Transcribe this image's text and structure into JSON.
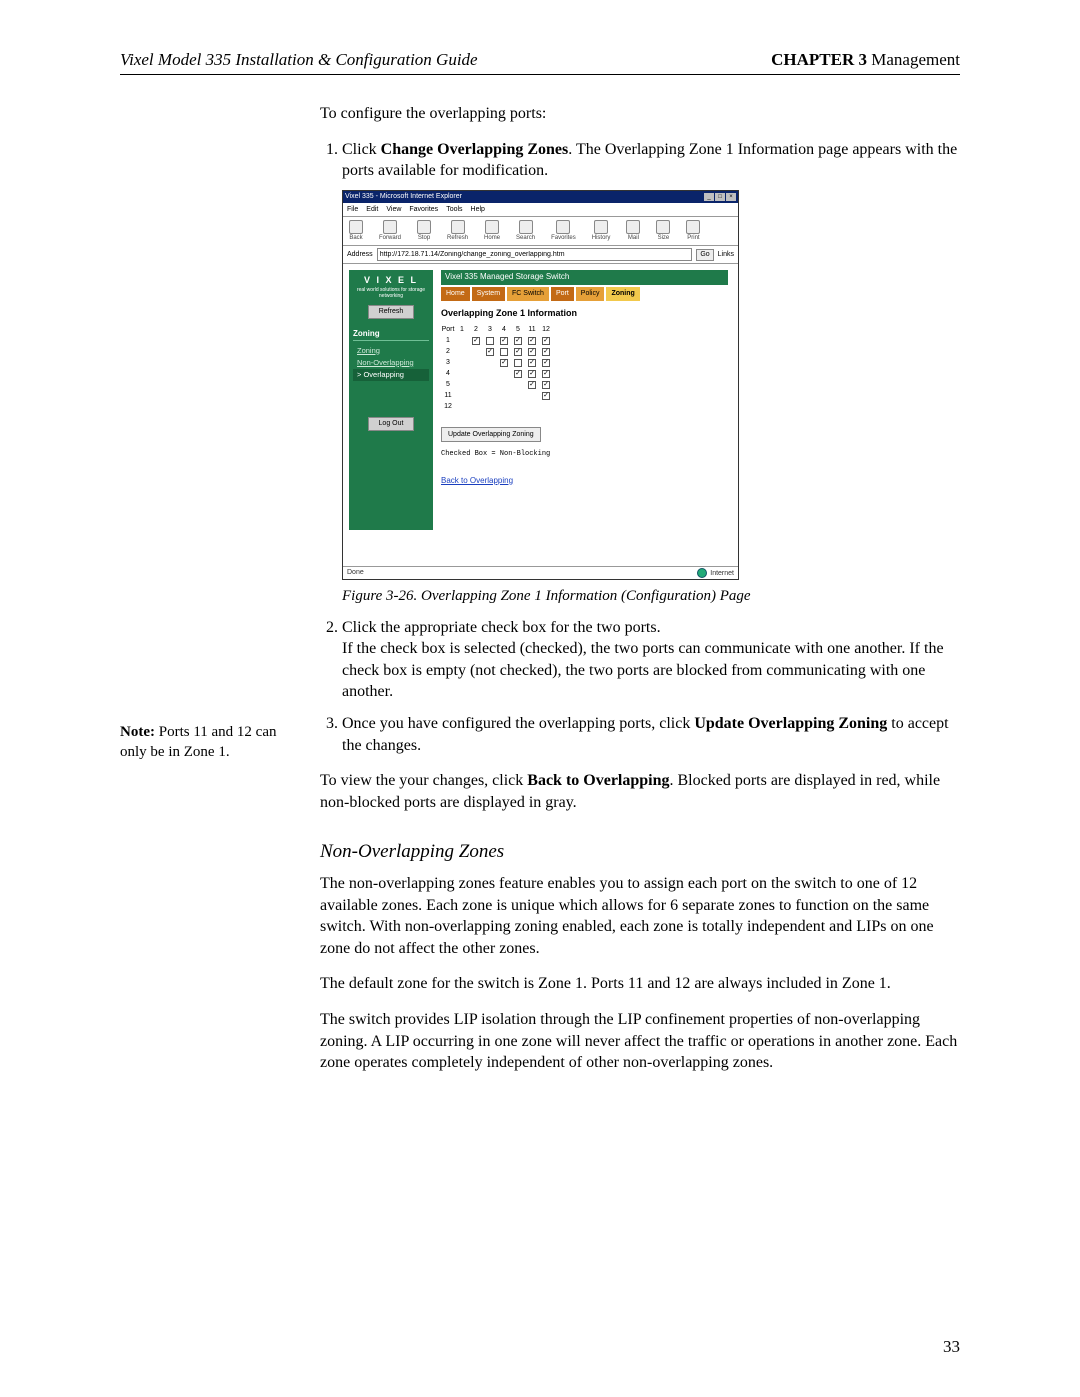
{
  "header": {
    "left": "Vixel Model 335 Installation & Configuration Guide",
    "chapter": "CHAPTER 3",
    "chapter_title": " Management"
  },
  "intro": "To configure the overlapping ports:",
  "step1_pre": "Click ",
  "step1_bold": "Change Overlapping Zones",
  "step1_post": ". The Overlapping Zone 1 Information page appears with the ports available for modification.",
  "figure_caption": "Figure 3-26. Overlapping Zone 1 Information (Configuration) Page",
  "step2_a": "Click the appropriate check box for the two ports.",
  "step2_b": "If the check box is selected (checked), the two ports can communicate with one another. If the check box is empty (not checked), the two ports are blocked from communicating with one another.",
  "step3_pre": "Once you have configured the overlapping ports, click ",
  "step3_bold": "Update Overlapping Zoning",
  "step3_post": " to accept the changes.",
  "view_pre": "To view the your changes, click ",
  "view_bold": "Back to Overlapping",
  "view_post": ". Blocked ports are displayed in red, while non-blocked ports are displayed in gray.",
  "subheading": "Non-Overlapping Zones",
  "margin_note_bold": "Note:",
  "margin_note": " Ports 11 and 12 can only be in Zone 1.",
  "para1": "The non-overlapping zones feature enables you to assign each port on the switch to one of 12 available zones. Each zone is unique which allows for 6 separate zones to function on the same switch. With non-overlapping zoning enabled, each zone is totally independent and LIPs on one zone do not affect the other zones.",
  "para2": "The default zone for the switch is Zone 1. Ports 11 and 12 are always included in Zone 1.",
  "para3": "The switch provides LIP isolation through the LIP confinement properties of non-overlapping zoning. A LIP occurring in one zone will never affect the traffic or operations in another zone. Each zone operates completely independent of other non-overlapping zones.",
  "page_number": "33",
  "screenshot": {
    "window_title": "Vixel 335 - Microsoft Internet Explorer",
    "menubar": [
      "File",
      "Edit",
      "View",
      "Favorites",
      "Tools",
      "Help"
    ],
    "toolbar": [
      "Back",
      "Forward",
      "Stop",
      "Refresh",
      "Home",
      "Search",
      "Favorites",
      "History",
      "Mail",
      "Size",
      "Print"
    ],
    "address_label": "Address",
    "address_url": "http://172.18.71.14/Zoning/change_zoning_overlapping.htm",
    "go_button": "Go",
    "links_label": "Links",
    "sidebar": {
      "logo": "V I X E L",
      "logo_sub": "real world solutions for storage networking",
      "refresh": "Refresh",
      "section": "Zoning",
      "links": {
        "zoning": "Zoning",
        "nonoverlapping": "Non-Overlapping",
        "overlapping": "Overlapping"
      },
      "logout": "Log Out"
    },
    "product_title": "Vixel 335 Managed Storage Switch",
    "tabs": [
      "Home",
      "System",
      "FC Switch",
      "Port",
      "Policy",
      "Zoning"
    ],
    "main_heading": "Overlapping Zone 1 Information",
    "col_port": "Port",
    "cols": [
      "1",
      "2",
      "3",
      "4",
      "5",
      "11",
      "12"
    ],
    "rows": [
      "1",
      "2",
      "3",
      "4",
      "5",
      "11",
      "12"
    ],
    "update_button": "Update Overlapping Zoning",
    "note_text": "Checked Box = Non-Blocking",
    "back_link": "Back to Overlapping",
    "status_done": "Done",
    "status_zone": "Internet"
  }
}
